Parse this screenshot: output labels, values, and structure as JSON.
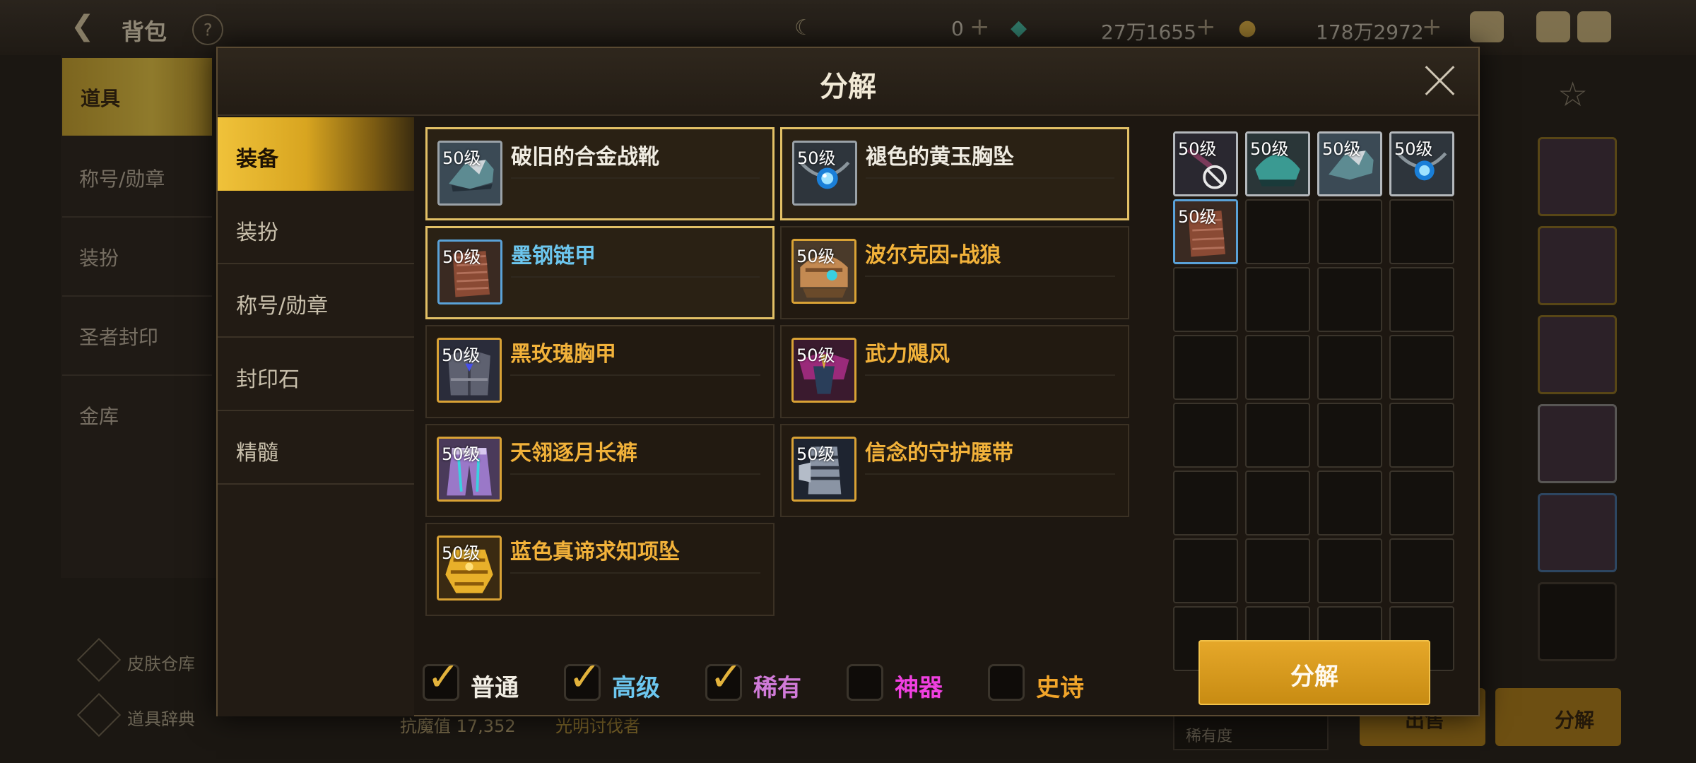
{
  "background": {
    "title": "背包",
    "help_glyph": "?",
    "currency": [
      {
        "icon": "moon-coin-icon",
        "value": "0"
      },
      {
        "icon": "green-crystal-icon",
        "value": "27万1655"
      },
      {
        "icon": "gold-coin-icon",
        "value": "178万2972"
      }
    ],
    "sidebar": {
      "active": "道具",
      "items": [
        "称号/勋章",
        "装扮",
        "圣者封印",
        "金库"
      ],
      "footer": [
        "皮肤仓库",
        "道具辞典"
      ]
    },
    "bottom_left_text": "抗魔值 17,352",
    "bottom_mid_text": "光明讨伐者",
    "sort_dropdown": "稀有度",
    "buttons": [
      "出售",
      "分解"
    ]
  },
  "modal": {
    "title": "分解",
    "categories": [
      {
        "label": "装备",
        "active": true
      },
      {
        "label": "装扮",
        "active": false
      },
      {
        "label": "称号/勋章",
        "active": false
      },
      {
        "label": "封印石",
        "active": false
      },
      {
        "label": "精髓",
        "active": false
      }
    ],
    "items": [
      {
        "name": "破旧的合金战靴",
        "level": "50级",
        "rarity": "common",
        "selected": true,
        "icon": "boots-icon"
      },
      {
        "name": "褪色的黄玉胸坠",
        "level": "50级",
        "rarity": "common",
        "selected": true,
        "icon": "amulet-icon"
      },
      {
        "name": "墨钢链甲",
        "level": "50级",
        "rarity": "advanced",
        "selected": true,
        "icon": "chainmail-icon"
      },
      {
        "name": "波尔克因-战狼",
        "level": "50级",
        "rarity": "rare",
        "selected": false,
        "icon": "helmet-icon"
      },
      {
        "name": "黑玫瑰胸甲",
        "level": "50级",
        "rarity": "rare",
        "selected": false,
        "icon": "breastplate-icon"
      },
      {
        "name": "武力飓风",
        "level": "50级",
        "rarity": "rare",
        "selected": false,
        "icon": "shoulder-armor-icon"
      },
      {
        "name": "天翎逐月长裤",
        "level": "50级",
        "rarity": "rare",
        "selected": false,
        "icon": "pants-icon"
      },
      {
        "name": "信念的守护腰带",
        "level": "50级",
        "rarity": "rare",
        "selected": false,
        "icon": "gauntlet-icon"
      },
      {
        "name": "蓝色真谛求知项坠",
        "level": "50级",
        "rarity": "rare",
        "selected": false,
        "icon": "necklace-icon"
      }
    ],
    "selection_slots": [
      {
        "level": "50级",
        "icon": "staff-forbidden-icon"
      },
      {
        "level": "50级",
        "icon": "helmet-teal-icon"
      },
      {
        "level": "50级",
        "icon": "boots-icon"
      },
      {
        "level": "50级",
        "icon": "amulet-icon"
      },
      {
        "level": "50级",
        "icon": "chainmail-icon"
      }
    ],
    "filters": [
      {
        "label": "普通",
        "checked": true,
        "color": "#f0ece2"
      },
      {
        "label": "高级",
        "checked": true,
        "color": "#6cc6ee"
      },
      {
        "label": "稀有",
        "checked": true,
        "color": "#d07ad8"
      },
      {
        "label": "神器",
        "checked": false,
        "color": "#f040e0"
      },
      {
        "label": "史诗",
        "checked": false,
        "color": "#f2a52a"
      }
    ],
    "check_glyph": "✓",
    "decompose_button": "分解"
  }
}
